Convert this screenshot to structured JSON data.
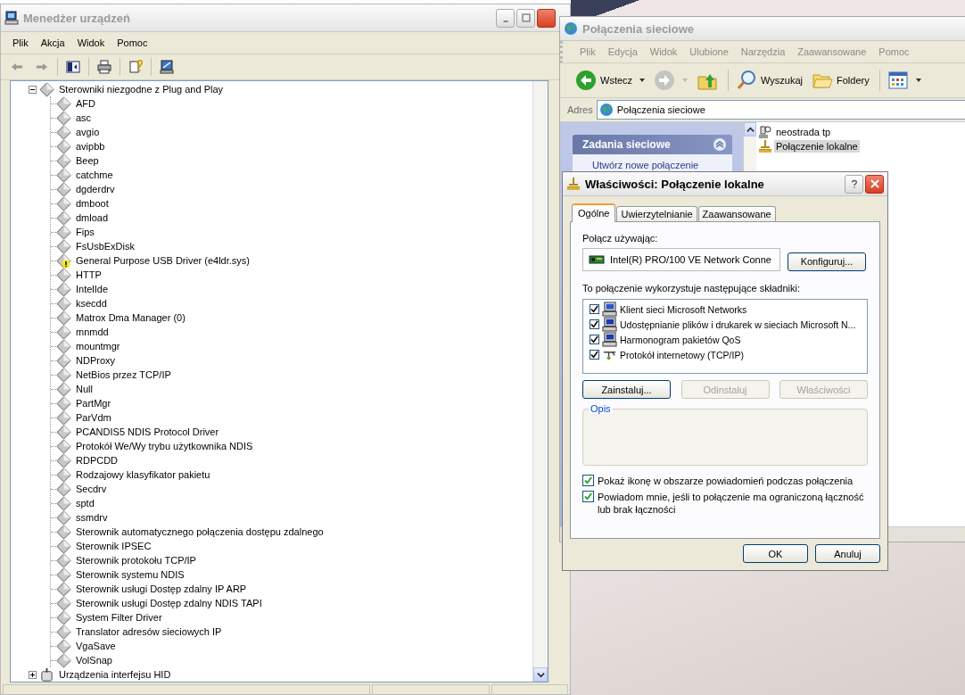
{
  "device_manager": {
    "title": "Menedżer urządzeń",
    "menu": [
      "Plik",
      "Akcja",
      "Widok",
      "Pomoc"
    ],
    "tree": [
      {
        "label": "Sterowniki niezgodne z Plug and Play",
        "kind": "driver",
        "expanded": true,
        "children": [
          {
            "label": "AFD",
            "warning": false
          },
          {
            "label": "asc",
            "warning": false
          },
          {
            "label": "avgio",
            "warning": false
          },
          {
            "label": "avipbb",
            "warning": false
          },
          {
            "label": "Beep",
            "warning": false
          },
          {
            "label": "catchme",
            "warning": false
          },
          {
            "label": "dgderdrv",
            "warning": false
          },
          {
            "label": "dmboot",
            "warning": false
          },
          {
            "label": "dmload",
            "warning": false
          },
          {
            "label": "Fips",
            "warning": false
          },
          {
            "label": "FsUsbExDisk",
            "warning": false
          },
          {
            "label": "General Purpose USB Driver (e4ldr.sys)",
            "warning": true
          },
          {
            "label": "HTTP",
            "warning": false
          },
          {
            "label": "IntelIde",
            "warning": false
          },
          {
            "label": "ksecdd",
            "warning": false
          },
          {
            "label": "Matrox Dma Manager (0)",
            "warning": false
          },
          {
            "label": "mnmdd",
            "warning": false
          },
          {
            "label": "mountmgr",
            "warning": false
          },
          {
            "label": "NDProxy",
            "warning": false
          },
          {
            "label": "NetBios przez TCP/IP",
            "warning": false
          },
          {
            "label": "Null",
            "warning": false
          },
          {
            "label": "PartMgr",
            "warning": false
          },
          {
            "label": "ParVdm",
            "warning": false
          },
          {
            "label": "PCANDIS5 NDIS Protocol Driver",
            "warning": false
          },
          {
            "label": "Protokół We/Wy trybu użytkownika NDIS",
            "warning": false
          },
          {
            "label": "RDPCDD",
            "warning": false
          },
          {
            "label": "Rodzajowy klasyfikator pakietu",
            "warning": false
          },
          {
            "label": "Secdrv",
            "warning": false
          },
          {
            "label": "sptd",
            "warning": false
          },
          {
            "label": "ssmdrv",
            "warning": false
          },
          {
            "label": "Sterownik automatycznego połączenia dostępu zdalnego",
            "warning": false
          },
          {
            "label": "Sterownik IPSEC",
            "warning": false
          },
          {
            "label": "Sterownik protokołu TCP/IP",
            "warning": false
          },
          {
            "label": "Sterownik systemu NDIS",
            "warning": false
          },
          {
            "label": "Sterownik usługi Dostęp zdalny IP ARP",
            "warning": false
          },
          {
            "label": "Sterownik usługi Dostęp zdalny NDIS TAPI",
            "warning": false
          },
          {
            "label": "System Filter Driver",
            "warning": false
          },
          {
            "label": "Translator adresów sieciowych IP",
            "warning": false
          },
          {
            "label": "VgaSave",
            "warning": false
          },
          {
            "label": "VolSnap",
            "warning": false
          }
        ]
      },
      {
        "label": "Urządzenia interfejsu HID",
        "kind": "hid",
        "expanded": false
      }
    ]
  },
  "network_connections": {
    "title": "Połączenia sieciowe",
    "menu": [
      "Plik",
      "Edycja",
      "Widok",
      "Ulubione",
      "Narzędzia",
      "Zaawansowane",
      "Pomoc"
    ],
    "toolbar": [
      {
        "kind": "back",
        "label": "Wstecz",
        "disabled": false
      },
      {
        "kind": "forward",
        "disabled": true
      },
      {
        "kind": "up"
      },
      {
        "kind": "search",
        "label": "Wyszukaj"
      },
      {
        "kind": "folders",
        "label": "Foldery"
      },
      {
        "kind": "views"
      }
    ],
    "address": {
      "label": "Adres",
      "value": "Połączenia sieciowe"
    },
    "task_panel": {
      "title": "Zadania sieciowe",
      "tasks": [
        "Utwórz nowe połączenie"
      ]
    },
    "connections": [
      {
        "name": "neostrada tp",
        "kind": "dialup",
        "selected": false
      },
      {
        "name": "Połączenie lokalne",
        "kind": "lan",
        "selected": true
      }
    ]
  },
  "dialog": {
    "title": "Właściwości: Połączenie lokalne",
    "tabs": [
      {
        "label": "Ogólne",
        "selected": true
      },
      {
        "label": "Uwierzytelnianie",
        "selected": false
      },
      {
        "label": "Zaawansowane",
        "selected": false
      }
    ],
    "connect_using_label": "Połącz używając:",
    "adapter": "Intel(R) PRO/100 VE Network Conne",
    "configure_button": "Konfiguruj...",
    "components_label": "To połączenie wykorzystuje następujące składniki:",
    "components": [
      {
        "label": "Klient sieci Microsoft Networks",
        "kind": "client",
        "checked": true
      },
      {
        "label": "Udostępnianie plików i drukarek w sieciach Microsoft N...",
        "kind": "service",
        "checked": true
      },
      {
        "label": "Harmonogram pakietów QoS",
        "kind": "service",
        "checked": true
      },
      {
        "label": "Protokół internetowy (TCP/IP)",
        "kind": "protocol",
        "checked": true
      }
    ],
    "component_buttons": [
      {
        "label": "Zainstaluj...",
        "disabled": false
      },
      {
        "label": "Odinstaluj",
        "disabled": true
      },
      {
        "label": "Właściwości",
        "disabled": true
      }
    ],
    "description_group": "Opis",
    "options": [
      {
        "label": "Pokaż ikonę w obszarze powiadomień podczas połączenia",
        "checked": true
      },
      {
        "label": "Powiadom mnie, jeśli to połączenie ma ograniczoną łączność lub brak łączności",
        "checked": true
      }
    ],
    "footer_buttons": [
      "OK",
      "Anuluj"
    ]
  }
}
